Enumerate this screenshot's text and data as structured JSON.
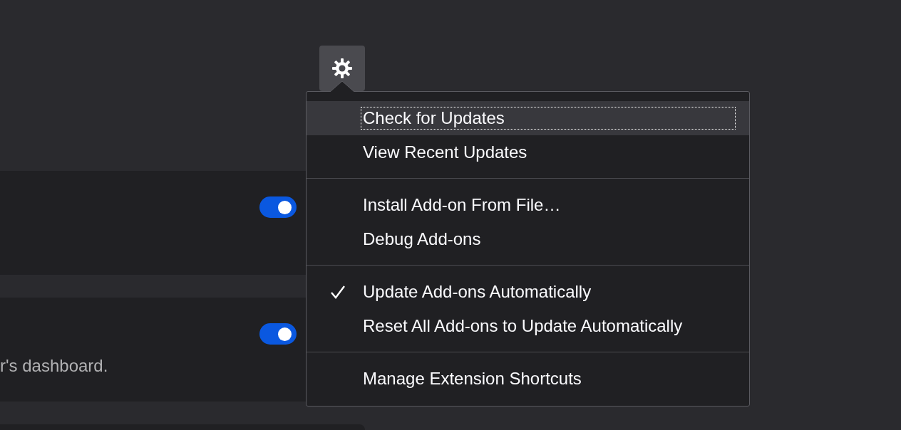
{
  "toolbar": {
    "settings_button": {
      "pressed": true
    }
  },
  "cards": [
    {
      "kind": "full",
      "toggle_on": true
    },
    {
      "kind": "full",
      "toggle_on": true,
      "description": "r's dashboard."
    },
    {
      "kind": "cut_off"
    }
  ],
  "menu": {
    "items": [
      {
        "kind": "item",
        "label": "Check for Updates",
        "checked": false,
        "selected": true
      },
      {
        "kind": "item",
        "label": "View Recent Updates",
        "checked": false,
        "selected": false
      },
      {
        "kind": "separator"
      },
      {
        "kind": "item",
        "label": "Install Add-on From File…",
        "checked": false,
        "selected": false
      },
      {
        "kind": "item",
        "label": "Debug Add-ons",
        "checked": false,
        "selected": false
      },
      {
        "kind": "separator"
      },
      {
        "kind": "item",
        "label": "Update Add-ons Automatically",
        "checked": true,
        "selected": false
      },
      {
        "kind": "item",
        "label": "Reset All Add-ons to Update Automatically",
        "checked": false,
        "selected": false
      },
      {
        "kind": "separator"
      },
      {
        "kind": "item",
        "label": "Manage Extension Shortcuts",
        "checked": false,
        "selected": false
      }
    ]
  }
}
